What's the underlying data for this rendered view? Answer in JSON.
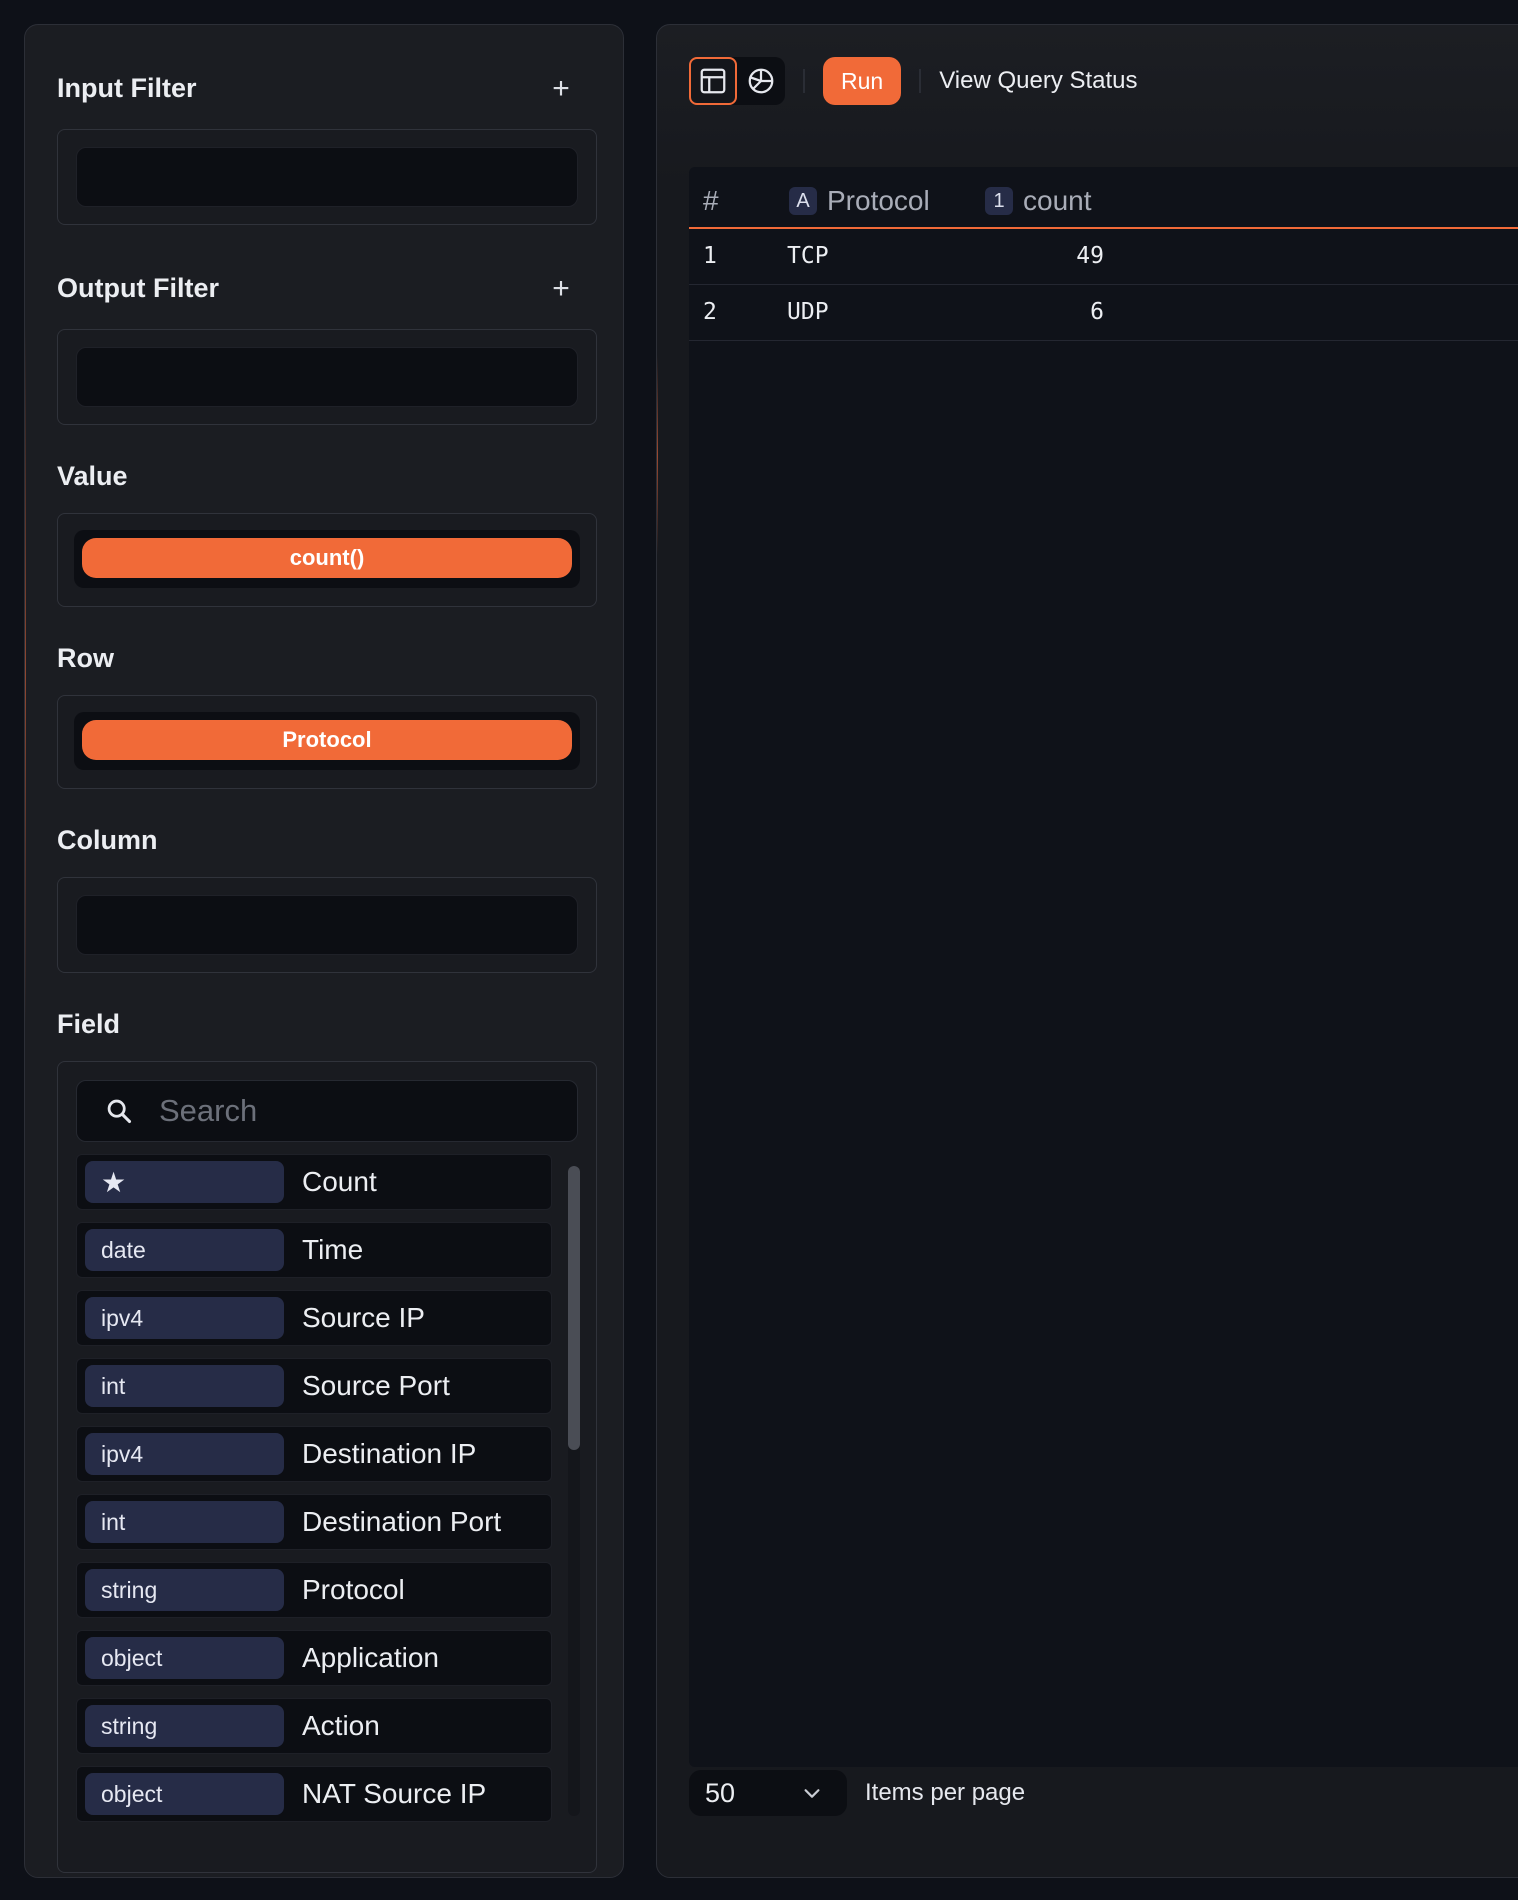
{
  "sidebar": {
    "input_filter": {
      "title": "Input Filter",
      "add_label": "+"
    },
    "output_filter": {
      "title": "Output Filter",
      "add_label": "+"
    },
    "value": {
      "title": "Value",
      "pill": "count()"
    },
    "row": {
      "title": "Row",
      "pill": "Protocol"
    },
    "column": {
      "title": "Column"
    },
    "field": {
      "title": "Field",
      "search_placeholder": "Search",
      "items": [
        {
          "type": "★",
          "name": "Count"
        },
        {
          "type": "date",
          "name": "Time"
        },
        {
          "type": "ipv4",
          "name": "Source IP"
        },
        {
          "type": "int",
          "name": "Source Port"
        },
        {
          "type": "ipv4",
          "name": "Destination IP"
        },
        {
          "type": "int",
          "name": "Destination Port"
        },
        {
          "type": "string",
          "name": "Protocol"
        },
        {
          "type": "object",
          "name": "Application"
        },
        {
          "type": "string",
          "name": "Action"
        },
        {
          "type": "object",
          "name": "NAT Source IP"
        }
      ]
    }
  },
  "toolbar": {
    "table_view_icon": "table-icon",
    "chart_view_icon": "pie-chart-icon",
    "run_label": "Run",
    "status_label": "View Query Status"
  },
  "table": {
    "columns": [
      {
        "badge": "",
        "label": "#"
      },
      {
        "badge": "A",
        "label": "Protocol"
      },
      {
        "badge": "1",
        "label": "count"
      }
    ],
    "rows": [
      {
        "index": "1",
        "protocol": "TCP",
        "count": "49"
      },
      {
        "index": "2",
        "protocol": "UDP",
        "count": "6"
      }
    ]
  },
  "pagination": {
    "page_size": "50",
    "items_label": "Items per page"
  },
  "colors": {
    "accent": "#f16a38",
    "chip": "#262c47",
    "background": "#0e1118"
  }
}
